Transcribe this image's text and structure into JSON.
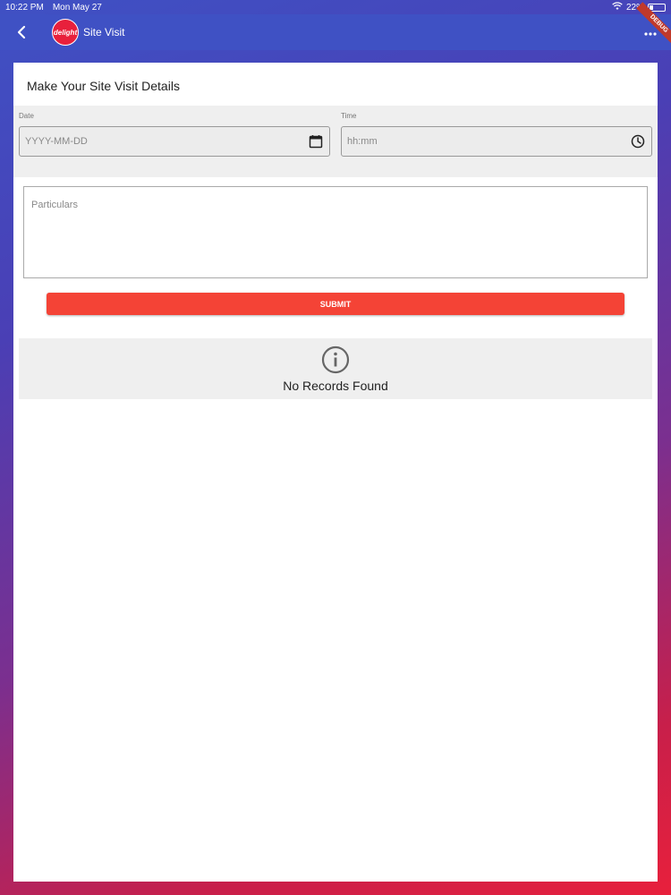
{
  "status_bar": {
    "time": "10:22 PM",
    "date": "Mon May 27",
    "battery": "22%"
  },
  "app_bar": {
    "logo_text": "delight",
    "title": "Site Visit",
    "debug_label": "DEBUG"
  },
  "form": {
    "heading": "Make Your Site Visit Details",
    "date_label": "Date",
    "date_placeholder": "YYYY-MM-DD",
    "time_label": "Time",
    "time_placeholder": "hh:mm",
    "particulars_placeholder": "Particulars",
    "submit_label": "SUBMIT"
  },
  "records": {
    "empty_message": "No Records Found"
  },
  "colors": {
    "app_bar": "#3f51c4",
    "submit": "#f44336",
    "logo": "#e8203c"
  }
}
